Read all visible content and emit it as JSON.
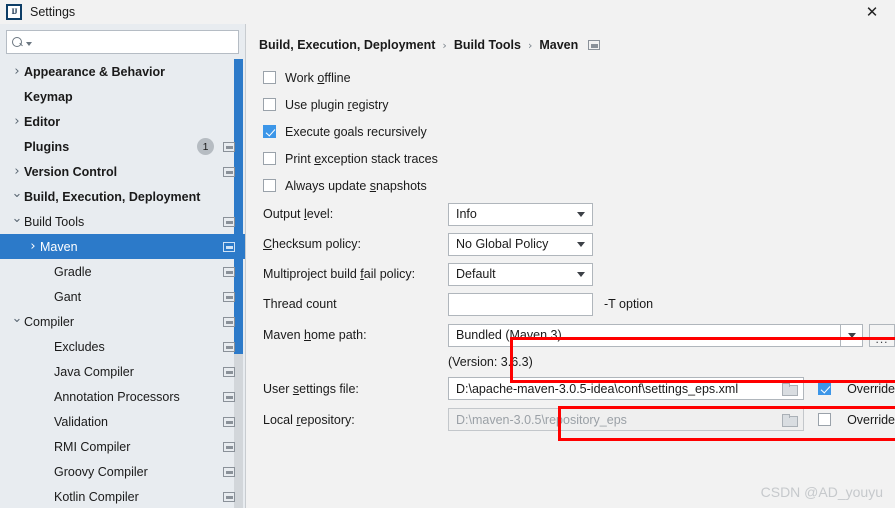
{
  "window": {
    "title": "Settings",
    "app_icon": "intellij-idea-icon",
    "close_label": "✕"
  },
  "sidebar": {
    "search": {
      "value": "",
      "placeholder": ""
    },
    "items": [
      {
        "label": "Appearance & Behavior",
        "indent": 0,
        "chevron": "›",
        "bold": true,
        "selected": false,
        "win_icon": false,
        "badge": ""
      },
      {
        "label": "Keymap",
        "indent": 1,
        "chevron": "",
        "bold": true,
        "selected": false,
        "win_icon": false,
        "badge": ""
      },
      {
        "label": "Editor",
        "indent": 0,
        "chevron": "›",
        "bold": true,
        "selected": false,
        "win_icon": false,
        "badge": ""
      },
      {
        "label": "Plugins",
        "indent": 1,
        "chevron": "",
        "bold": true,
        "selected": false,
        "win_icon": true,
        "badge": "1"
      },
      {
        "label": "Version Control",
        "indent": 0,
        "chevron": "›",
        "bold": true,
        "selected": false,
        "win_icon": true,
        "badge": ""
      },
      {
        "label": "Build, Execution, Deployment",
        "indent": 0,
        "chevron": "⌄",
        "bold": true,
        "selected": false,
        "win_icon": false,
        "badge": ""
      },
      {
        "label": "Build Tools",
        "indent": 1,
        "chevron": "⌄",
        "bold": false,
        "selected": false,
        "win_icon": true,
        "badge": ""
      },
      {
        "label": "Maven",
        "indent": 2,
        "chevron": "›",
        "bold": false,
        "selected": true,
        "win_icon": true,
        "badge": ""
      },
      {
        "label": "Gradle",
        "indent": 3,
        "chevron": "",
        "bold": false,
        "selected": false,
        "win_icon": true,
        "badge": ""
      },
      {
        "label": "Gant",
        "indent": 3,
        "chevron": "",
        "bold": false,
        "selected": false,
        "win_icon": true,
        "badge": ""
      },
      {
        "label": "Compiler",
        "indent": 1,
        "chevron": "⌄",
        "bold": false,
        "selected": false,
        "win_icon": true,
        "badge": ""
      },
      {
        "label": "Excludes",
        "indent": 3,
        "chevron": "",
        "bold": false,
        "selected": false,
        "win_icon": true,
        "badge": ""
      },
      {
        "label": "Java Compiler",
        "indent": 3,
        "chevron": "",
        "bold": false,
        "selected": false,
        "win_icon": true,
        "badge": ""
      },
      {
        "label": "Annotation Processors",
        "indent": 3,
        "chevron": "",
        "bold": false,
        "selected": false,
        "win_icon": true,
        "badge": ""
      },
      {
        "label": "Validation",
        "indent": 3,
        "chevron": "",
        "bold": false,
        "selected": false,
        "win_icon": true,
        "badge": ""
      },
      {
        "label": "RMI Compiler",
        "indent": 3,
        "chevron": "",
        "bold": false,
        "selected": false,
        "win_icon": true,
        "badge": ""
      },
      {
        "label": "Groovy Compiler",
        "indent": 3,
        "chevron": "",
        "bold": false,
        "selected": false,
        "win_icon": true,
        "badge": ""
      },
      {
        "label": "Kotlin Compiler",
        "indent": 3,
        "chevron": "",
        "bold": false,
        "selected": false,
        "win_icon": true,
        "badge": ""
      }
    ]
  },
  "breadcrumb": {
    "part1": "Build, Execution, Deployment",
    "part2": "Build Tools",
    "part3": "Maven",
    "separator": "›"
  },
  "checkboxes": [
    {
      "label_pre": "Work ",
      "mnemonic": "o",
      "label_post": "ffline",
      "checked": false
    },
    {
      "label_pre": "Use plugin ",
      "mnemonic": "r",
      "label_post": "egistry",
      "checked": false
    },
    {
      "label_pre": "Execute ",
      "mnemonic": "g",
      "label_post": "oals recursively",
      "checked": true
    },
    {
      "label_pre": "Print ",
      "mnemonic": "e",
      "label_post": "xception stack traces",
      "checked": false
    },
    {
      "label_pre": "Always update ",
      "mnemonic": "s",
      "label_post": "napshots",
      "checked": false
    }
  ],
  "fields": {
    "output_level": {
      "label_pre": "Output ",
      "mnemonic": "l",
      "label_post": "evel:",
      "value": "Info"
    },
    "checksum_policy": {
      "label_pre": "",
      "mnemonic": "C",
      "label_post": "hecksum policy:",
      "value": "No Global Policy"
    },
    "multiproject_policy": {
      "label_pre": "Multiproject build ",
      "mnemonic": "f",
      "label_post": "ail policy:",
      "value": "Default"
    },
    "thread_count": {
      "label": "Thread count",
      "value": "",
      "suffix": "-T option"
    },
    "maven_home": {
      "label_pre": "Maven ",
      "mnemonic": "h",
      "label_post": "ome path:",
      "value": "Bundled (Maven 3)",
      "browse_label": "...",
      "version_note": "(Version: 3.6.3)"
    },
    "user_settings": {
      "label_pre": "User ",
      "mnemonic": "s",
      "label_post": "ettings file:",
      "value": "D:\\apache-maven-3.0.5-idea\\conf\\settings_eps.xml",
      "override_label": "Override",
      "override_checked": true
    },
    "local_repository": {
      "label_pre": "Local ",
      "mnemonic": "r",
      "label_post": "epository:",
      "value": "D:\\maven-3.0.5\\repository_eps",
      "override_label": "Override",
      "override_checked": false
    }
  },
  "watermark": "CSDN @AD_youyu",
  "colors": {
    "selection_blue": "#2c7ac9",
    "checkbox_blue": "#3c96e8",
    "highlight_red": "#ff0000",
    "sidebar_bg": "#e8ecf0",
    "panel_bg": "#f2f2f2"
  }
}
